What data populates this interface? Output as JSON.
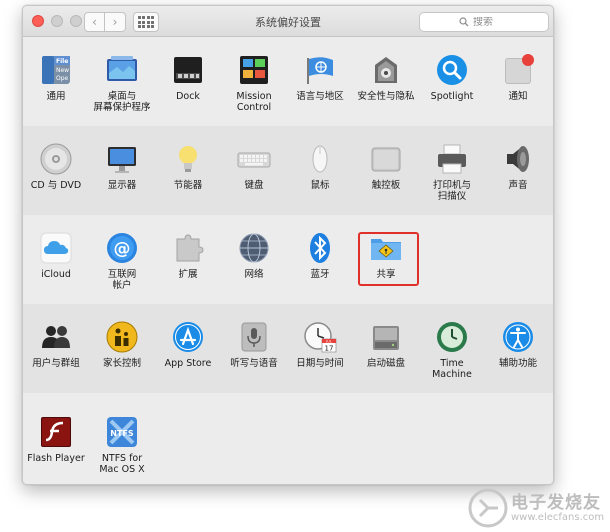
{
  "window": {
    "title": "系统偏好设置",
    "search_placeholder": "搜索",
    "nav_back_glyph": "‹",
    "nav_forward_glyph": "›"
  },
  "sections": [
    {
      "items": [
        {
          "label": "通用",
          "icon": "general-icon"
        },
        {
          "label": "桌面与\n屏幕保护程序",
          "icon": "desktop-screensaver-icon"
        },
        {
          "label": "Dock",
          "icon": "dock-icon"
        },
        {
          "label": "Mission\nControl",
          "icon": "mission-control-icon"
        },
        {
          "label": "语言与地区",
          "icon": "language-region-icon"
        },
        {
          "label": "安全性与隐私",
          "icon": "security-privacy-icon"
        },
        {
          "label": "Spotlight",
          "icon": "spotlight-icon"
        },
        {
          "label": "通知",
          "icon": "notifications-icon"
        }
      ]
    },
    {
      "items": [
        {
          "label": "CD 与 DVD",
          "icon": "cd-dvd-icon"
        },
        {
          "label": "显示器",
          "icon": "displays-icon"
        },
        {
          "label": "节能器",
          "icon": "energy-saver-icon"
        },
        {
          "label": "键盘",
          "icon": "keyboard-icon"
        },
        {
          "label": "鼠标",
          "icon": "mouse-icon"
        },
        {
          "label": "触控板",
          "icon": "trackpad-icon"
        },
        {
          "label": "打印机与\n扫描仪",
          "icon": "printers-scanners-icon"
        },
        {
          "label": "声音",
          "icon": "sound-icon"
        }
      ]
    },
    {
      "items": [
        {
          "label": "iCloud",
          "icon": "icloud-icon"
        },
        {
          "label": "互联网\n帐户",
          "icon": "internet-accounts-icon"
        },
        {
          "label": "扩展",
          "icon": "extensions-icon"
        },
        {
          "label": "网络",
          "icon": "network-icon"
        },
        {
          "label": "蓝牙",
          "icon": "bluetooth-icon"
        },
        {
          "label": "共享",
          "icon": "sharing-icon"
        }
      ]
    },
    {
      "items": [
        {
          "label": "用户与群组",
          "icon": "users-groups-icon"
        },
        {
          "label": "家长控制",
          "icon": "parental-controls-icon"
        },
        {
          "label": "App Store",
          "icon": "app-store-icon"
        },
        {
          "label": "听写与语音",
          "icon": "dictation-speech-icon"
        },
        {
          "label": "日期与时间",
          "icon": "date-time-icon"
        },
        {
          "label": "启动磁盘",
          "icon": "startup-disk-icon"
        },
        {
          "label": "Time Machine",
          "icon": "time-machine-icon"
        },
        {
          "label": "辅助功能",
          "icon": "accessibility-icon"
        }
      ]
    },
    {
      "items": [
        {
          "label": "Flash Player",
          "icon": "flash-player-icon"
        },
        {
          "label": "NTFS for\nMac OS X",
          "icon": "ntfs-icon"
        }
      ]
    }
  ],
  "icon_text": {
    "general_file": "File",
    "general_new": "New",
    "general_ope": "Ope",
    "date_month": "JUL",
    "date_day": "17",
    "ntfs": "NTFS",
    "notif_badge": ""
  },
  "watermark": {
    "text": "电子发烧友",
    "url": "www.elecfans.com"
  },
  "colors": {
    "highlight_border": "#e0302a",
    "accent_blue": "#1e88e5"
  }
}
